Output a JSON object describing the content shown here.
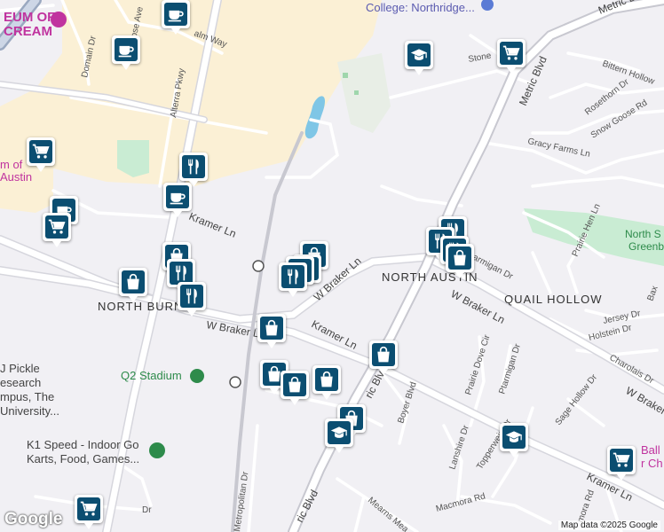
{
  "map": {
    "attribution": "Map data ©2025 Google",
    "logo": "Google",
    "labels": {
      "museum_ice_cream_1": "EUM OF",
      "museum_ice_cream_2": "CREAM",
      "college": "College: Northridge...",
      "metric_blvd": "Metric Blvd",
      "metric_blvd_2": "Metric Blvd",
      "metric_blvd_3": "ric Blvd",
      "metric_blvd_4": "ric Blvd",
      "domain_dr": "Domain Dr",
      "rose_ave": "Rose Ave",
      "palm_way": "alm Way",
      "alterra_pkwy": "Alterra Pkwy",
      "stone": "Stone",
      "bittern_hollow": "Bittern Hollow",
      "rosethorn_dr": "Rosethorn Dr",
      "snow_goose_rd": "Snow Goose Rd",
      "gracy_farms_ln": "Gracy Farms Ln",
      "museum_austin_1": "m of",
      "museum_austin_2": "Austin",
      "kramer_ln_1": "Kramer Ln",
      "kramer_ln_2": "Kramer Ln",
      "kramer_ln_3": "Kramer Ln",
      "w_braker_ln_1": "W Braker Ln",
      "w_braker_ln_2": "W Braker Ln",
      "w_braker_ln_3": "W Braker Ln",
      "w_braker_ln_4": "W Braker Ln",
      "ptarmigan_dr": "armigan Dr",
      "prairie_hen_ln": "Prairie Hen Ln",
      "north_s": "North S",
      "greenb": "Greenb",
      "north_austin": "NORTH AUSTIN",
      "quail_hollow": "QUAIL HOLLOW",
      "north_burnet": "NORTH BURNET",
      "jersey_dr": "Jersey Dr",
      "holstein_dr": "Holstein Dr",
      "charolais_dr": "Charolais Dr",
      "prairie_dove_cir": "Prairie Dove Cir",
      "ptarmigan_dr_2": "Ptarmigan Dr",
      "sage_hollow_dr": "Sage Hollow Dr",
      "pickle_1": "J Pickle",
      "pickle_2": "esearch",
      "pickle_3": "mpus, The",
      "pickle_4": "University...",
      "q2_stadium": "Q2 Stadium",
      "boyer_blvd": "Boyer Blvd",
      "lanshire_dr": "Lanshire Dr",
      "topperwein_dr": "Topperwein Dr",
      "k1_speed_1": "K1 Speed - Indoor Go",
      "k1_speed_2": "Karts, Food, Games...",
      "metropolitan_dr": "Metropolitan Dr",
      "macmora_rd": "Macmora Rd",
      "mearns_meadow": "Mearns Mea",
      "macmora_rd_2": "mora Rd",
      "ball_1": "Ball",
      "ball_2": "r Ch",
      "dr": "Dr",
      "bax": "Bax"
    },
    "colors": {
      "background": "#f1f0f4",
      "road": "#ffffff",
      "road_edge": "#d6d6dd",
      "commercial": "#fbf0d5",
      "park": "#c9ecd3",
      "water": "#7fc6e6",
      "marker": "#0b4e71",
      "poi_pink": "#c0339f",
      "poi_green": "#2e8b4b"
    },
    "markers": [
      {
        "icon": "coffee-cup-icon"
      },
      {
        "icon": "coffee-cup-icon"
      },
      {
        "icon": "graduation-cap-icon"
      },
      {
        "icon": "shopping-cart-icon"
      },
      {
        "icon": "shopping-cart-icon"
      },
      {
        "icon": "utensils-icon"
      },
      {
        "icon": "coffee-cup-icon"
      },
      {
        "icon": "coffee-cup-icon"
      },
      {
        "icon": "shopping-cart-icon"
      },
      {
        "icon": "shopping-bag-icon"
      },
      {
        "icon": "shopping-bag-icon"
      },
      {
        "icon": "utensils-icon"
      },
      {
        "icon": "utensils-icon"
      },
      {
        "icon": "shopping-bag-icon"
      },
      {
        "icon": "shopping-bag-icon"
      },
      {
        "icon": "utensils-icon"
      },
      {
        "icon": "utensils-icon"
      },
      {
        "icon": "utensils-icon"
      },
      {
        "icon": "utensils-icon"
      },
      {
        "icon": "utensils-icon"
      },
      {
        "icon": "shopping-bag-icon"
      },
      {
        "icon": "shopping-bag-icon"
      },
      {
        "icon": "shopping-bag-icon"
      },
      {
        "icon": "shopping-bag-icon"
      },
      {
        "icon": "shopping-bag-icon"
      },
      {
        "icon": "shopping-bag-icon"
      },
      {
        "icon": "shopping-bag-icon"
      },
      {
        "icon": "graduation-cap-icon"
      },
      {
        "icon": "graduation-cap-icon"
      },
      {
        "icon": "shopping-cart-icon"
      },
      {
        "icon": "shopping-cart-icon"
      }
    ]
  }
}
